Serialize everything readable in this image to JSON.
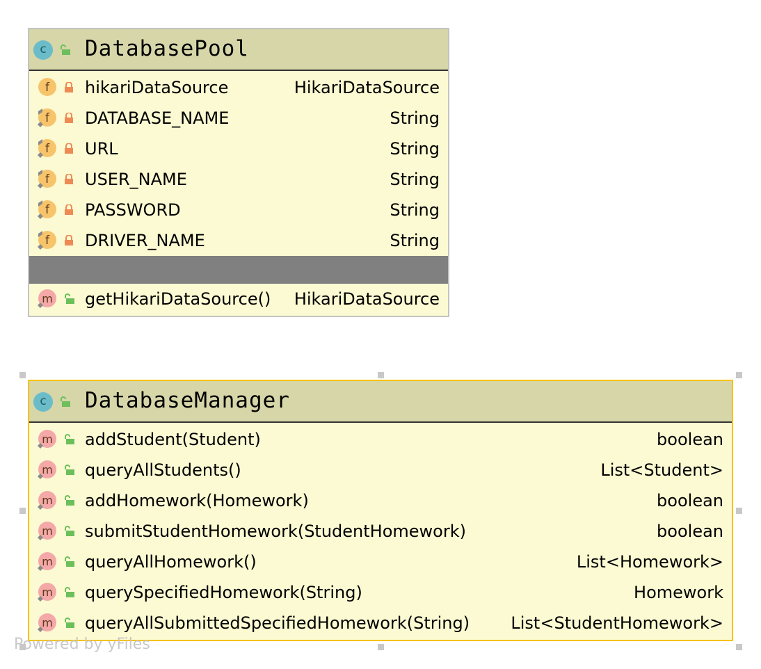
{
  "classes": [
    {
      "name": "DatabasePool",
      "kind_letter": "c",
      "fields": [
        {
          "name": "hikariDataSource",
          "type": "HikariDataSource",
          "icon": "field-private-icon"
        },
        {
          "name": "DATABASE_NAME",
          "type": "String",
          "icon": "field-static-private-icon"
        },
        {
          "name": "URL",
          "type": "String",
          "icon": "field-static-private-icon"
        },
        {
          "name": "USER_NAME",
          "type": "String",
          "icon": "field-static-private-icon"
        },
        {
          "name": "PASSWORD",
          "type": "String",
          "icon": "field-static-private-icon"
        },
        {
          "name": "DRIVER_NAME",
          "type": "String",
          "icon": "field-static-private-icon"
        }
      ],
      "methods": [
        {
          "name": "getHikariDataSource()",
          "type": "HikariDataSource"
        }
      ]
    },
    {
      "name": "DatabaseManager",
      "kind_letter": "c",
      "methods": [
        {
          "name": "addStudent(Student)",
          "type": "boolean"
        },
        {
          "name": "queryAllStudents()",
          "type": "List<Student>"
        },
        {
          "name": "addHomework(Homework)",
          "type": "boolean"
        },
        {
          "name": "submitStudentHomework(StudentHomework)",
          "type": "boolean"
        },
        {
          "name": "queryAllHomework()",
          "type": "List<Homework>"
        },
        {
          "name": "querySpecifiedHomework(String)",
          "type": "Homework"
        },
        {
          "name": "queryAllSubmittedSpecifiedHomework(String)",
          "type": "List<StudentHomework>"
        }
      ]
    }
  ],
  "watermark": "Powered by yFiles",
  "colors": {
    "box_fill": "#fbfad2",
    "header_fill": "#d6d6a9",
    "selected_border": "#f7c200",
    "field_icon": "#f7c46c",
    "method_icon": "#f4a8a8",
    "lock_private": "#ee8a53",
    "lock_public": "#6cbf5a"
  }
}
